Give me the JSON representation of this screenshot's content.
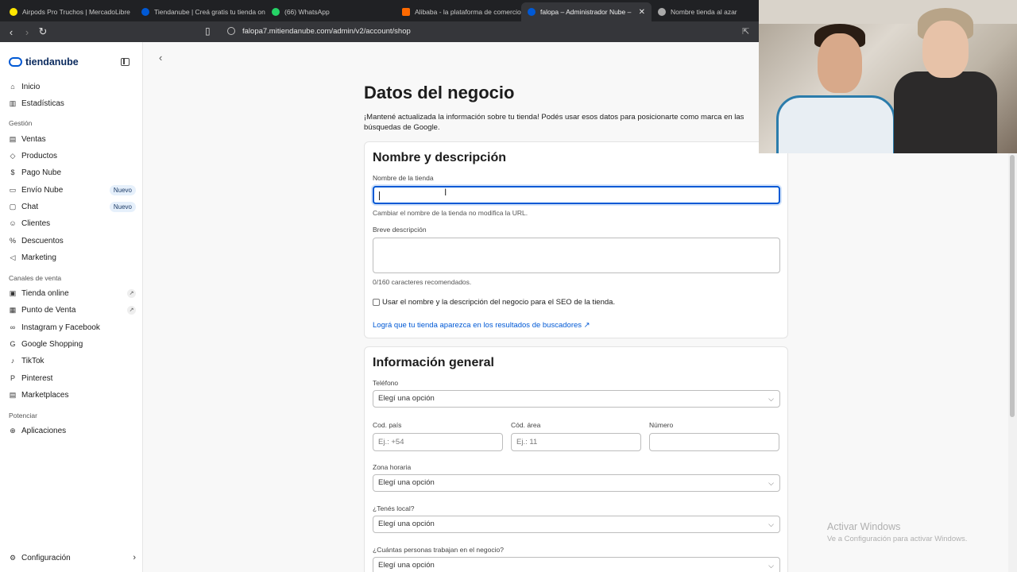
{
  "browser": {
    "tabs": [
      {
        "title": "Airpods Pro Truchos | MercadoLibre",
        "icon": "mercadolibre-icon",
        "color": "#ffe600"
      },
      {
        "title": "Tiendanube | Creá gratis tu tienda on",
        "icon": "tiendanube-icon",
        "color": "#0059d5"
      },
      {
        "title": "(66) WhatsApp",
        "icon": "whatsapp-icon",
        "color": "#25d366"
      },
      {
        "title": "Alibaba - la plataforma de comercio",
        "icon": "alibaba-icon",
        "color": "#ff6a00"
      },
      {
        "title": "falopa – Administrador Nube –",
        "icon": "tiendanube-icon",
        "color": "#0059d5",
        "active": true
      },
      {
        "title": "Nombre tienda al azar",
        "icon": "chatgpt-icon",
        "color": "#aaaaaa"
      }
    ],
    "url": "falopa7.mitiendanube.com/admin/v2/account/shop"
  },
  "sidebar": {
    "brand": "tiendanube",
    "items": [
      {
        "label": "Inicio",
        "icon": "home-icon"
      },
      {
        "label": "Estadísticas",
        "icon": "chart-icon"
      },
      {
        "label": "Ventas",
        "icon": "inbox-icon"
      },
      {
        "label": "Productos",
        "icon": "tag-icon"
      },
      {
        "label": "Pago Nube",
        "icon": "dollar-icon"
      },
      {
        "label": "Envío Nube",
        "icon": "truck-icon",
        "badge": "Nuevo"
      },
      {
        "label": "Chat",
        "icon": "chat-icon",
        "badge": "Nuevo"
      },
      {
        "label": "Clientes",
        "icon": "users-icon"
      },
      {
        "label": "Descuentos",
        "icon": "discount-icon"
      },
      {
        "label": "Marketing",
        "icon": "megaphone-icon"
      },
      {
        "label": "Tienda online",
        "icon": "store-icon"
      },
      {
        "label": "Punto de Venta",
        "icon": "pos-icon"
      },
      {
        "label": "Instagram y Facebook",
        "icon": "meta-icon"
      },
      {
        "label": "Google Shopping",
        "icon": "google-icon"
      },
      {
        "label": "TikTok",
        "icon": "tiktok-icon"
      },
      {
        "label": "Pinterest",
        "icon": "pinterest-icon"
      },
      {
        "label": "Marketplaces",
        "icon": "marketplace-icon"
      },
      {
        "label": "Aplicaciones",
        "icon": "apps-icon"
      },
      {
        "label": "Configuración",
        "icon": "gear-icon"
      }
    ],
    "sections": [
      "Gestión",
      "Canales de venta",
      "Potenciar"
    ]
  },
  "page": {
    "title": "Datos del negocio",
    "description": "¡Mantené actualizada la información sobre tu tienda! Podés usar esos datos para posicionarte como marca en las búsquedas de Google."
  },
  "card1": {
    "title": "Nombre y descripción",
    "store_name_label": "Nombre de la tienda",
    "store_name_value": "",
    "store_name_help": "Cambiar el nombre de la tienda no modifica la URL.",
    "description_label": "Breve descripción",
    "description_counter": "0/160 caracteres recomendados.",
    "seo_checkbox_label": "Usar el nombre y la descripción del negocio para el SEO de la tienda.",
    "seo_link": "Lográ que tu tienda aparezca en los resultados de buscadores"
  },
  "card2": {
    "title": "Información general",
    "phone_label": "Teléfono",
    "phone_select": "Elegí una opción",
    "country_code_label": "Cod. país",
    "country_code_placeholder": "Ej.: +54",
    "area_code_label": "Cód. área",
    "area_code_placeholder": "Ej.: 11",
    "number_label": "Número",
    "timezone_label": "Zona horaria",
    "timezone_select": "Elegí una opción",
    "local_label": "¿Tenés local?",
    "local_select": "Elegí una opción",
    "employees_label": "¿Cuántas personas trabajan en el negocio?",
    "employees_select": "Elegí una opción"
  },
  "watermark": {
    "line1": "Activar Windows",
    "line2": "Ve a Configuración para activar Windows."
  }
}
